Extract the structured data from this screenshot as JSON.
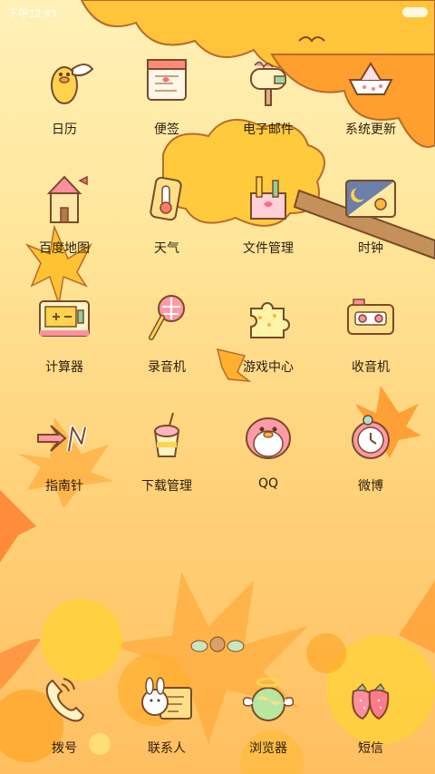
{
  "status_bar": {
    "time": "下午12:43"
  },
  "apps": [
    {
      "label": "日历",
      "icon": "duck-icon"
    },
    {
      "label": "便签",
      "icon": "notepad-icon"
    },
    {
      "label": "电子邮件",
      "icon": "mailbox-icon"
    },
    {
      "label": "系统更新",
      "icon": "paper-boat-icon"
    },
    {
      "label": "百度地图",
      "icon": "castle-icon"
    },
    {
      "label": "天气",
      "icon": "thermometer-icon"
    },
    {
      "label": "文件管理",
      "icon": "pencil-box-icon"
    },
    {
      "label": "时钟",
      "icon": "day-night-icon"
    },
    {
      "label": "计算器",
      "icon": "calculator-icon"
    },
    {
      "label": "录音机",
      "icon": "microphone-icon"
    },
    {
      "label": "游戏中心",
      "icon": "puzzle-icon"
    },
    {
      "label": "收音机",
      "icon": "cassette-icon"
    },
    {
      "label": "指南针",
      "icon": "arrow-n-icon"
    },
    {
      "label": "下载管理",
      "icon": "drink-cup-icon"
    },
    {
      "label": "QQ",
      "icon": "penguin-icon"
    },
    {
      "label": "微博",
      "icon": "alarm-clock-icon"
    }
  ],
  "dock": [
    {
      "label": "拨号",
      "icon": "phone-icon"
    },
    {
      "label": "联系人",
      "icon": "bunny-card-icon"
    },
    {
      "label": "浏览器",
      "icon": "globe-angel-icon"
    },
    {
      "label": "短信",
      "icon": "strawberry-icon"
    }
  ],
  "colors": {
    "outline": "#7a4a2a",
    "leaf": "#ffad2e",
    "cloud": "#ffc533"
  }
}
